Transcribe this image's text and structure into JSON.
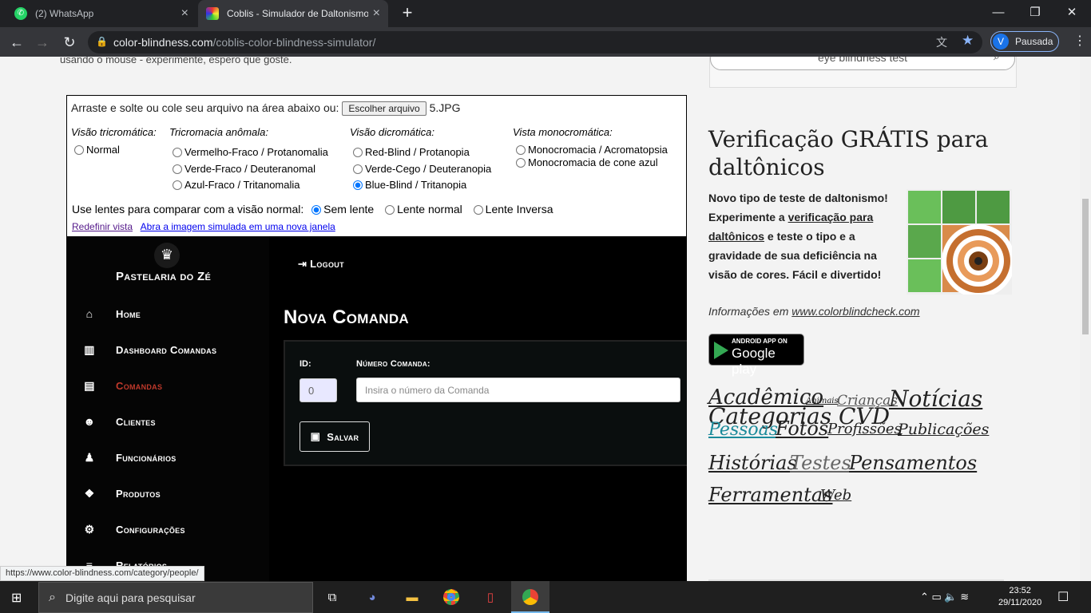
{
  "browser": {
    "tabs": [
      {
        "title": "(2) WhatsApp",
        "active": false
      },
      {
        "title": "Coblis - Simulador de Daltonismo",
        "active": true
      }
    ],
    "url_domain": "color-blindness.com",
    "url_path": "/coblis-color-blindness-simulator/",
    "profile_initial": "V",
    "profile_label": "Pausada"
  },
  "page": {
    "intro_text": "usando o mouse - experimente, espero que goste.",
    "coblis": {
      "upload_label": "Arraste e solte ou cole seu arquivo na área abaixo ou:",
      "file_button": "Escolher arquivo",
      "file_name": "5.JPG",
      "groups": [
        {
          "title": "Visão tricromática:",
          "options": [
            {
              "label": "Normal",
              "checked": false
            }
          ]
        },
        {
          "title": "Tricromacia anômala:",
          "options": [
            {
              "label": "Vermelho-Fraco / Protanomalia",
              "checked": false
            },
            {
              "label": "Verde-Fraco / Deuteranomal",
              "checked": false
            },
            {
              "label": "Azul-Fraco / Tritanomalia",
              "checked": false
            }
          ]
        },
        {
          "title": "Visão dicromática:",
          "options": [
            {
              "label": "Red-Blind / Protanopia",
              "checked": false
            },
            {
              "label": "Verde-Cego / Deuteranopia",
              "checked": false
            },
            {
              "label": "Blue-Blind / Tritanopia",
              "checked": true
            }
          ]
        },
        {
          "title": "Vista monocromática:",
          "options": [
            {
              "label": "Monocromacia / Acromatopsia",
              "checked": false
            },
            {
              "label": "Monocromacia de cone azul",
              "checked": false
            }
          ]
        }
      ],
      "lens_label": "Use lentes para comparar com a visão normal:",
      "lens_options": [
        {
          "label": "Sem lente",
          "checked": true
        },
        {
          "label": "Lente normal",
          "checked": false
        },
        {
          "label": "Lente Inversa",
          "checked": false
        }
      ],
      "link_reset": "Redefinir vista",
      "link_open": "Abra a imagem simulada em uma nova janela"
    },
    "app": {
      "brand": "Pastelaria do Zé",
      "logout": "Logout",
      "menu": [
        {
          "label": "Home",
          "icon": "home-icon",
          "glyph": "⌂",
          "active": false
        },
        {
          "label": "Dashboard Comandas",
          "icon": "bar-chart-icon",
          "glyph": "▥",
          "active": false
        },
        {
          "label": "Comandas",
          "icon": "id-card-icon",
          "glyph": "▤",
          "active": true
        },
        {
          "label": "Clientes",
          "icon": "users-icon",
          "glyph": "☻",
          "active": false
        },
        {
          "label": "Funcionários",
          "icon": "user-icon",
          "glyph": "♟",
          "active": false
        },
        {
          "label": "Produtos",
          "icon": "cubes-icon",
          "glyph": "❖",
          "active": false
        },
        {
          "label": "Configurações",
          "icon": "gears-icon",
          "glyph": "⚙",
          "active": false
        },
        {
          "label": "Relatórios",
          "icon": "report-icon",
          "glyph": "≡",
          "active": false
        }
      ],
      "page_title": "Nova Comanda",
      "id_label": "ID:",
      "id_value": "0",
      "numero_label": "Número Comanda:",
      "numero_placeholder": "Insira o número da Comanda",
      "save_label": "Salvar",
      "active_color": "#c0392b"
    },
    "sidebar": {
      "search_value": "eye blindness test",
      "verif_title": "Verificação GRÁTIS para daltônicos",
      "desc_1": "Novo tipo de teste de daltonismo! Experimente a ",
      "desc_link": "verificação para daltônicos",
      "desc_2": " e teste o tipo e a gravidade de sua deficiência na visão de cores. Fácil e divertido!",
      "info_prefix": "Informações em ",
      "info_link": "www.colorblindcheck.com",
      "gp_small": "ANDROID APP ON",
      "gp_big": "Google play",
      "cat_title": "Categorias CVD",
      "categories": [
        {
          "label": "Acadêmico",
          "size": 26,
          "color": "#222"
        },
        {
          "label": "Animais",
          "size": 10,
          "color": "#222"
        },
        {
          "label": "Crianças",
          "size": 17,
          "color": "#555"
        },
        {
          "label": "Notícias",
          "size": 28,
          "color": "#222"
        },
        {
          "label": "Pessoas",
          "size": 22,
          "color": "#1a8a9a"
        },
        {
          "label": "Fotos",
          "size": 24,
          "color": "#222"
        },
        {
          "label": "Profissões",
          "size": 18,
          "color": "#222"
        },
        {
          "label": "Publicações",
          "size": 19,
          "color": "#222"
        },
        {
          "label": "Histórias",
          "size": 24,
          "color": "#222"
        },
        {
          "label": "Testes",
          "size": 24,
          "color": "#666"
        },
        {
          "label": "Pensamentos",
          "size": 24,
          "color": "#222"
        },
        {
          "label": "Ferramentas",
          "size": 24,
          "color": "#222"
        },
        {
          "label": "Web",
          "size": 18,
          "color": "#222"
        }
      ]
    }
  },
  "status_url": "https://www.color-blindness.com/category/people/",
  "taskbar": {
    "search_placeholder": "Digite aqui para pesquisar",
    "time": "23:52",
    "date": "29/11/2020"
  }
}
